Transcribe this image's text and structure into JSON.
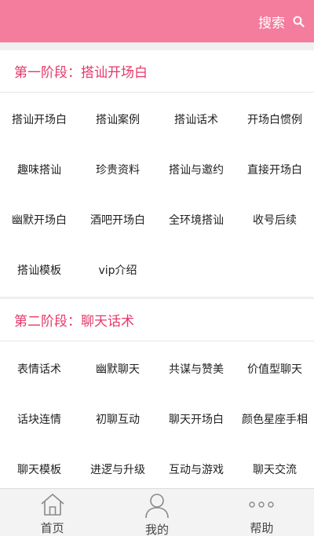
{
  "header": {
    "search_label": "搜索"
  },
  "sections": [
    {
      "title": "第一阶段：搭讪开场白",
      "items": [
        "搭讪开场白",
        "搭讪案例",
        "搭讪话术",
        "开场白惯例",
        "趣味搭讪",
        "珍贵资料",
        "搭讪与邀约",
        "直接开场白",
        "幽默开场白",
        "酒吧开场白",
        "全环境搭讪",
        "收号后续",
        "搭讪模板",
        "vip介绍"
      ]
    },
    {
      "title": "第二阶段：聊天话术",
      "items": [
        "表情话术",
        "幽默聊天",
        "共谋与赞美",
        "价值型聊天",
        "话块连情",
        "初聊互动",
        "聊天开场白",
        "颜色星座手相",
        "聊天模板",
        "进逻与升级",
        "互动与游戏",
        "聊天交流"
      ]
    }
  ],
  "tabbar": {
    "tabs": [
      {
        "label": "首页",
        "icon": "home-icon"
      },
      {
        "label": "我的",
        "icon": "user-icon"
      },
      {
        "label": "帮助",
        "icon": "more-dots-icon"
      }
    ]
  },
  "colors": {
    "header_bg": "#f47c9c",
    "section_title": "#e5386a"
  }
}
